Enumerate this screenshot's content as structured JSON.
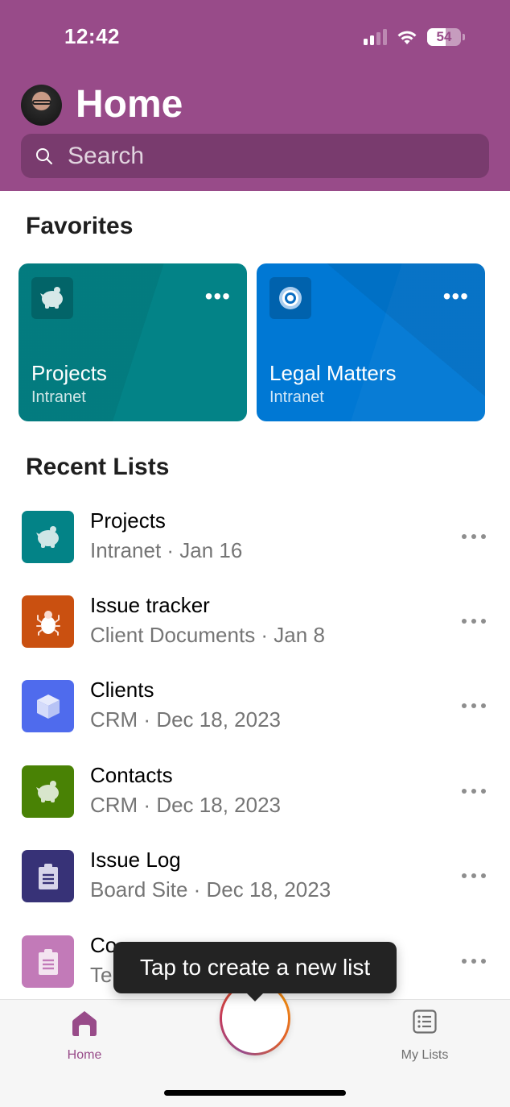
{
  "status_bar": {
    "time": "12:42",
    "battery_percent": "54",
    "battery_level": 0.54,
    "signal_bars_active": 2,
    "signal_bars_total": 4
  },
  "header": {
    "title": "Home",
    "avatar": "user-avatar",
    "search_placeholder": "Search",
    "color": "#984b89"
  },
  "favorites": {
    "title": "Favorites",
    "items": [
      {
        "title": "Projects",
        "subtitle": "Intranet",
        "icon": "piggy-bank-icon",
        "color": "#038387"
      },
      {
        "title": "Legal Matters",
        "subtitle": "Intranet",
        "icon": "target-icon",
        "color": "#0078d4"
      }
    ]
  },
  "recent": {
    "title": "Recent Lists",
    "items": [
      {
        "title": "Projects",
        "subtitle": "Intranet · Jan 16",
        "icon": "piggy-bank-icon",
        "color": "#038387"
      },
      {
        "title": "Issue tracker",
        "subtitle": "Client Documents · Jan 8",
        "icon": "bug-icon",
        "color": "#ca5010"
      },
      {
        "title": "Clients",
        "subtitle": "CRM · Dec 18, 2023",
        "icon": "cube-icon",
        "color": "#4f6bed"
      },
      {
        "title": "Contacts",
        "subtitle": "CRM · Dec 18, 2023",
        "icon": "piggy-bank-icon",
        "color": "#498205"
      },
      {
        "title": "Issue Log",
        "subtitle": "Board Site · Dec 18, 2023",
        "icon": "clipboard-icon",
        "color": "#373277"
      },
      {
        "title": "Co",
        "subtitle": "Te",
        "icon": "clipboard-icon",
        "color": "#c27ab8"
      }
    ]
  },
  "tooltip": {
    "text": "Tap to create a new list"
  },
  "tabbar": {
    "home_label": "Home",
    "my_lists_label": "My Lists",
    "active_color": "#984b89",
    "inactive_color": "#6e6e6e"
  }
}
